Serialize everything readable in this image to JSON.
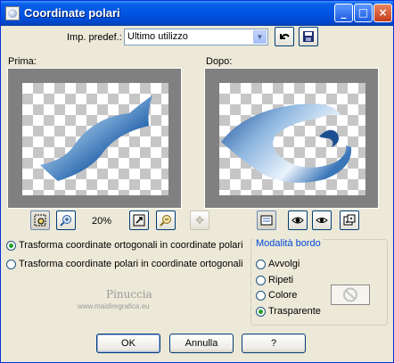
{
  "window": {
    "title": "Coordinate polari",
    "min": "_",
    "max": "□",
    "close": "×"
  },
  "preset": {
    "label": "Imp. predef.:",
    "value": "Ultimo utilizzo"
  },
  "preview": {
    "before_label": "Prima:",
    "after_label": "Dopo:",
    "zoom": "20%"
  },
  "options": [
    {
      "label": "Trasforma coordinate ortogonali in coordinate polari",
      "selected": true
    },
    {
      "label": "Trasforma coordinate polari in coordinate ortogonali",
      "selected": false
    }
  ],
  "edge": {
    "title": "Modalità bordo",
    "items": [
      {
        "label": "Avvolgi",
        "selected": false
      },
      {
        "label": "Ripeti",
        "selected": false
      },
      {
        "label": "Colore",
        "selected": false
      },
      {
        "label": "Trasparente",
        "selected": true
      }
    ]
  },
  "watermark": {
    "name": "Pinuccia",
    "url": "www.maidiregrafica.eu"
  },
  "buttons": {
    "ok": "OK",
    "cancel": "Annulla",
    "help": "?"
  },
  "colors": {
    "title_bar": "#0054e3",
    "dialog_bg": "#ece9d8",
    "group_title": "#0046d5",
    "shape_blue": "#2d6fb0"
  }
}
